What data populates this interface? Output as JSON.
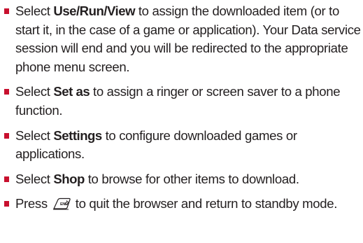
{
  "items": [
    {
      "pre": "Select ",
      "bold": "Use/Run/View",
      "post": " to assign the downloaded item (or to start it, in the case of a game or application). Your Data service session will end and you will be redirected to the appropriate phone menu screen."
    },
    {
      "pre": "Select ",
      "bold": "Set as",
      "post": " to assign a ringer or screen saver to a phone function."
    },
    {
      "pre": "Select ",
      "bold": "Settings",
      "post": " to configure downloaded games or applications."
    },
    {
      "pre": "Select ",
      "bold": "Shop",
      "post": " to browse for other items to download."
    },
    {
      "pre": "Press",
      "key_icon": "end-key-icon",
      "post": "to quit the browser and return to standby mode."
    }
  ],
  "colors": {
    "bullet": "#c8102e",
    "text": "#231f20"
  }
}
